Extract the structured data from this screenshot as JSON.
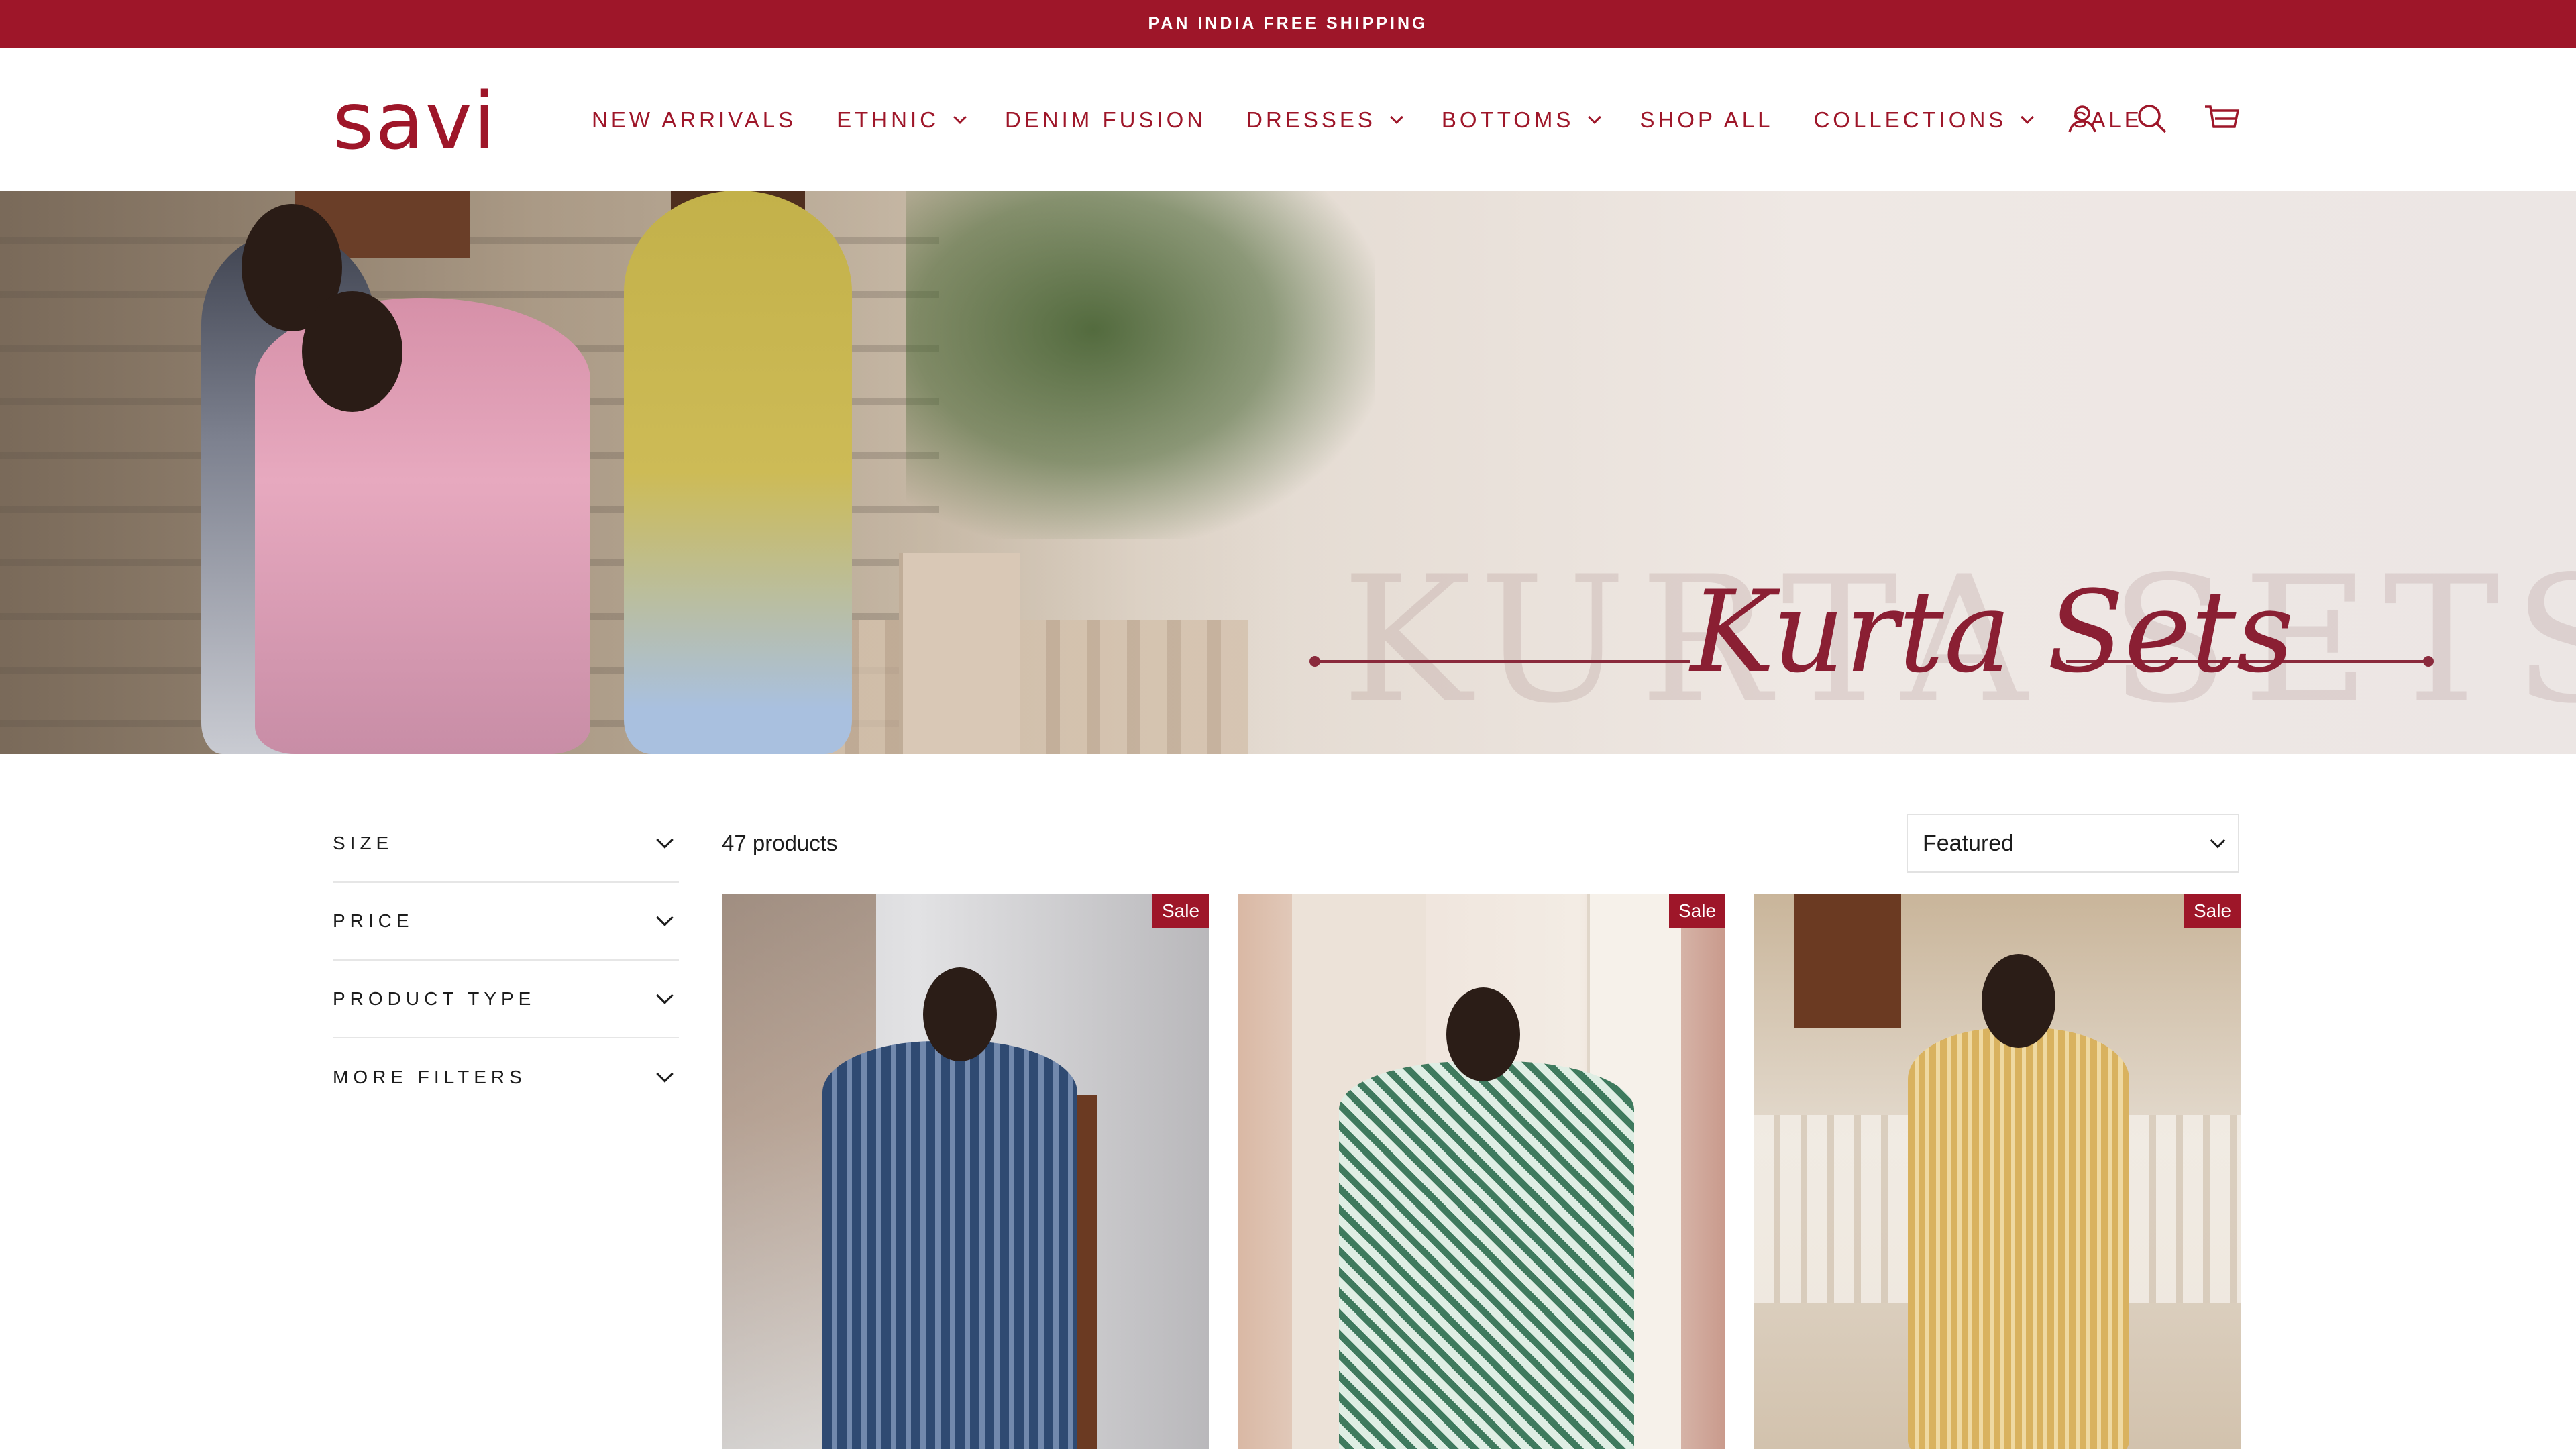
{
  "announcement": {
    "text": "PAN INDIA FREE SHIPPING"
  },
  "brand": {
    "logo_text": "savi",
    "accent_color": "#9e1629"
  },
  "nav": {
    "items": [
      {
        "label": "NEW ARRIVALS",
        "has_dropdown": false
      },
      {
        "label": "ETHNIC",
        "has_dropdown": true
      },
      {
        "label": "DENIM FUSION",
        "has_dropdown": false
      },
      {
        "label": "DRESSES",
        "has_dropdown": true
      },
      {
        "label": "BOTTOMS",
        "has_dropdown": true
      },
      {
        "label": "SHOP ALL",
        "has_dropdown": false
      },
      {
        "label": "COLLECTIONS",
        "has_dropdown": true
      },
      {
        "label": "SALE",
        "has_dropdown": false
      }
    ]
  },
  "header_icons": [
    "account-icon",
    "search-icon",
    "cart-icon"
  ],
  "hero": {
    "title": "Kurta Sets",
    "ghost_text": "KURTA SETS"
  },
  "filters": {
    "items": [
      {
        "label": "SIZE"
      },
      {
        "label": "PRICE"
      },
      {
        "label": "PRODUCT TYPE"
      },
      {
        "label": "MORE FILTERS"
      }
    ]
  },
  "toolbar": {
    "count_text": "47 products",
    "sort_selected": "Featured"
  },
  "products": [
    {
      "badge": "Sale"
    },
    {
      "badge": "Sale"
    },
    {
      "badge": "Sale"
    }
  ]
}
